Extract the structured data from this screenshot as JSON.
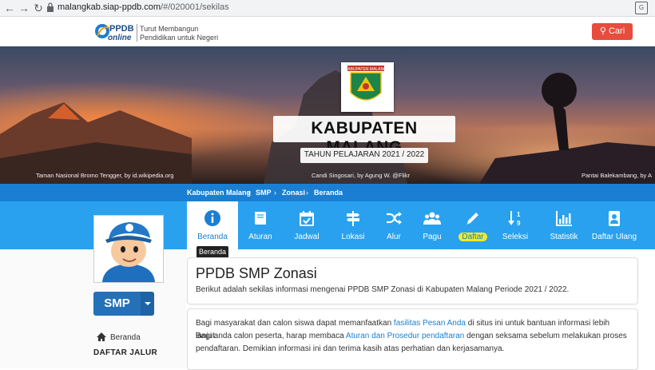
{
  "browser": {
    "url_host": "malangkab.siap-ppdb.com",
    "url_path": "/#/020001/sekilas"
  },
  "header": {
    "logo_text": "PPDB online",
    "tagline_line1": "Turut Membangun",
    "tagline_line2": "Pendidikan untuk Negeri",
    "search_label": "Cari"
  },
  "banner": {
    "title": "KABUPATEN MALANG",
    "year": "TAHUN PELAJARAN 2021 / 2022",
    "emblem_text": "KABUPATEN MALANG",
    "caption_left": "Taman Nasional Bromo Tengger, by id.wikipedia.org",
    "caption_center": "Candi Singosari, by Agung W. @Flikr",
    "caption_right": "Pantai Balekambang, by A"
  },
  "breadcrumb": [
    "Kabupaten Malang",
    "SMP",
    "Zonasi",
    "Beranda"
  ],
  "breadcrumb_sep": "›",
  "nav": {
    "items": [
      {
        "label": "Beranda",
        "icon": "info-icon"
      },
      {
        "label": "Aturan",
        "icon": "book-icon"
      },
      {
        "label": "Jadwal",
        "icon": "calendar-icon"
      },
      {
        "label": "Lokasi",
        "icon": "signpost-icon"
      },
      {
        "label": "Alur",
        "icon": "shuffle-icon"
      },
      {
        "label": "Pagu",
        "icon": "users-icon"
      },
      {
        "label": "Daftar",
        "icon": "pencil-icon"
      },
      {
        "label": "Seleksi",
        "icon": "sort-numeric-icon"
      },
      {
        "label": "Statistik",
        "icon": "bar-chart-icon"
      },
      {
        "label": "Daftar Ulang",
        "icon": "id-card-icon"
      }
    ],
    "tooltip": "Beranda"
  },
  "sidebar": {
    "level_label": "SMP",
    "home_label": "Beranda",
    "section_heading": "DAFTAR JALUR"
  },
  "main": {
    "title": "PPDB SMP Zonasi",
    "subtitle": "Berikut adalah sekilas informasi mengenai PPDB SMP Zonasi di Kabupaten Malang Periode 2021 / 2022.",
    "p1_a": "Bagi masyarakat dan calon siswa dapat memanfaatkan ",
    "p1_link": "fasilitas Pesan Anda",
    "p1_b": " di situs ini untuk bantuan informasi lebih lanjut.",
    "p2_a": "Bagi anda calon peserta, harap membaca ",
    "p2_link": "Aturan dan Prosedur pendaftaran",
    "p2_b": " dengan seksama sebelum melakukan proses",
    "p3": "pendaftaran. Demikian informasi ini dan terima kasih atas perhatian dan kerjasamanya."
  },
  "colors": {
    "primary": "#1a7fd3",
    "nav_bg": "#29a1ef",
    "search_btn": "#e74c3c",
    "highlight": "#f4ea28",
    "smp_btn": "#2471b8"
  }
}
